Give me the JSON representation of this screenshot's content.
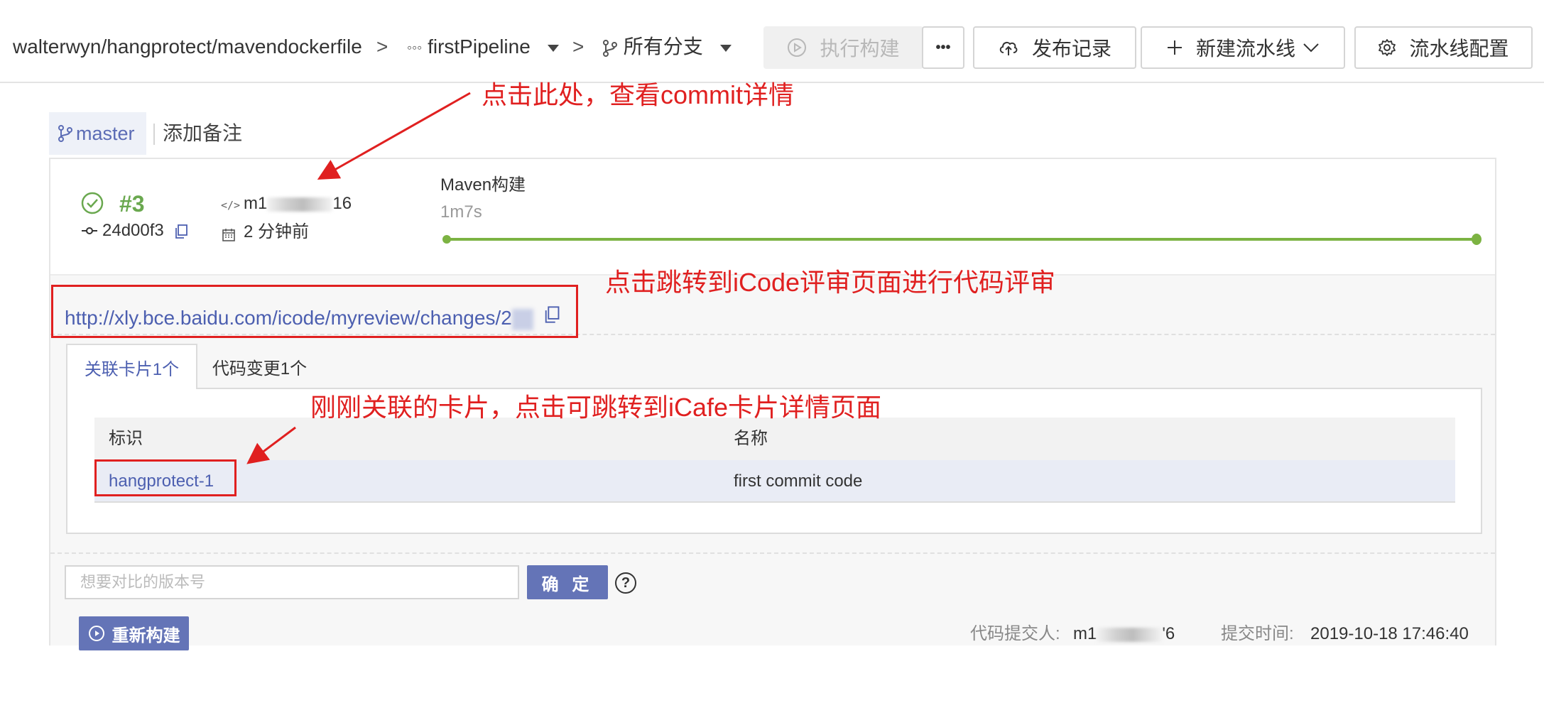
{
  "breadcrumb": {
    "repo_path": "walterwyn/hangprotect/mavendockerfile",
    "separator": ">",
    "pipeline": "firstPipeline",
    "branch_filter": "所有分支"
  },
  "toolbar": {
    "run_build": "执行构建",
    "more": "•••",
    "release_records": "发布记录",
    "new_pipeline": "新建流水线",
    "pipeline_config": "流水线配置"
  },
  "branch": {
    "name": "master",
    "add_note": "添加备注"
  },
  "build": {
    "number": "#3",
    "commit_hash": "24d00f3",
    "author_prefix": "m1",
    "author_suffix": "16",
    "time_ago": "2 分钟前",
    "stage_name": "Maven构建",
    "stage_duration": "1m7s",
    "stage_progress": 1.0,
    "status_color": "#6aa84f"
  },
  "review": {
    "url": "http://xly.bce.baidu.com/icode/myreview/changes/2"
  },
  "tabs": [
    {
      "label": "关联卡片1个",
      "active": true
    },
    {
      "label": "代码变更1个",
      "active": false
    }
  ],
  "cards_table": {
    "headers": [
      "标识",
      "名称"
    ],
    "rows": [
      {
        "id": "hangprotect-1",
        "name": "first commit code"
      }
    ]
  },
  "compare": {
    "placeholder": "想要对比的版本号",
    "confirm": "确 定",
    "help": "?"
  },
  "footer": {
    "rebuild": "重新构建",
    "committer_label": "代码提交人:",
    "committer_prefix": "m1",
    "committer_suffix": "'6",
    "commit_time_label": "提交时间:",
    "commit_time": "2019-10-18 17:46:40"
  },
  "annotations": {
    "commit_hint": "点击此处，查看commit详情",
    "review_hint": "点击跳转到iCode评审页面进行代码评审",
    "card_hint": "刚刚关联的卡片，点击可跳转到iCafe卡片详情页面"
  },
  "colors": {
    "accent": "#4c5fb0",
    "success": "#7cb342",
    "annotation": "#e02020",
    "primary_button": "#6474b7"
  },
  "icons": [
    "pipeline-icon",
    "branch-icon",
    "play-circle-icon",
    "cloud-upload-icon",
    "plus-icon",
    "chevron-down-icon",
    "gear-icon",
    "check-circle-icon",
    "commit-icon",
    "code-icon",
    "calendar-icon",
    "copy-icon",
    "help-icon",
    "rebuild-icon"
  ]
}
